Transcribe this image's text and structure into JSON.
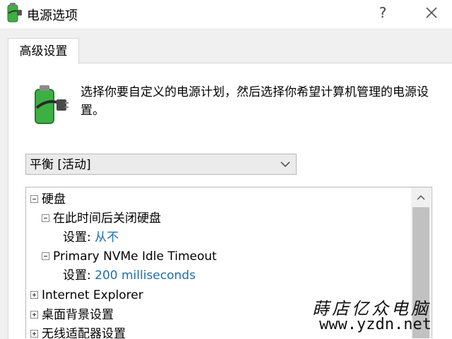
{
  "window": {
    "title": "电源选项",
    "help_label": "?",
    "icons": {
      "app": "battery-plug-icon",
      "close": "close-icon"
    }
  },
  "tab": {
    "label": "高级设置"
  },
  "description": {
    "icon": "battery-plug-icon",
    "text": "选择你要自定义的电源计划，然后选择你希望计算机管理的电源设置。"
  },
  "plan_select": {
    "value": "平衡 [活动]",
    "icon": "chevron-down-icon"
  },
  "tree": {
    "items": [
      {
        "expander": "minus",
        "label": "硬盘"
      },
      {
        "expander": "minus",
        "label": "在此时间后关闭硬盘"
      },
      {
        "label_prefix": "设置:",
        "value": "从不"
      },
      {
        "expander": "minus",
        "label": "Primary NVMe Idle Timeout"
      },
      {
        "label_prefix": "设置:",
        "value": "200 milliseconds"
      },
      {
        "expander": "plus",
        "label": "Internet Explorer"
      },
      {
        "expander": "plus",
        "label": "桌面背景设置"
      },
      {
        "expander": "plus",
        "label": "无线适配器设置"
      }
    ]
  },
  "watermark": {
    "title": "蒔店亿众电脑",
    "url": "www.yzdn.net"
  },
  "colors": {
    "setting_value": "#1a6fb0",
    "battery_green": "#3cb043",
    "scroll_thumb": "#c1c1c1"
  }
}
